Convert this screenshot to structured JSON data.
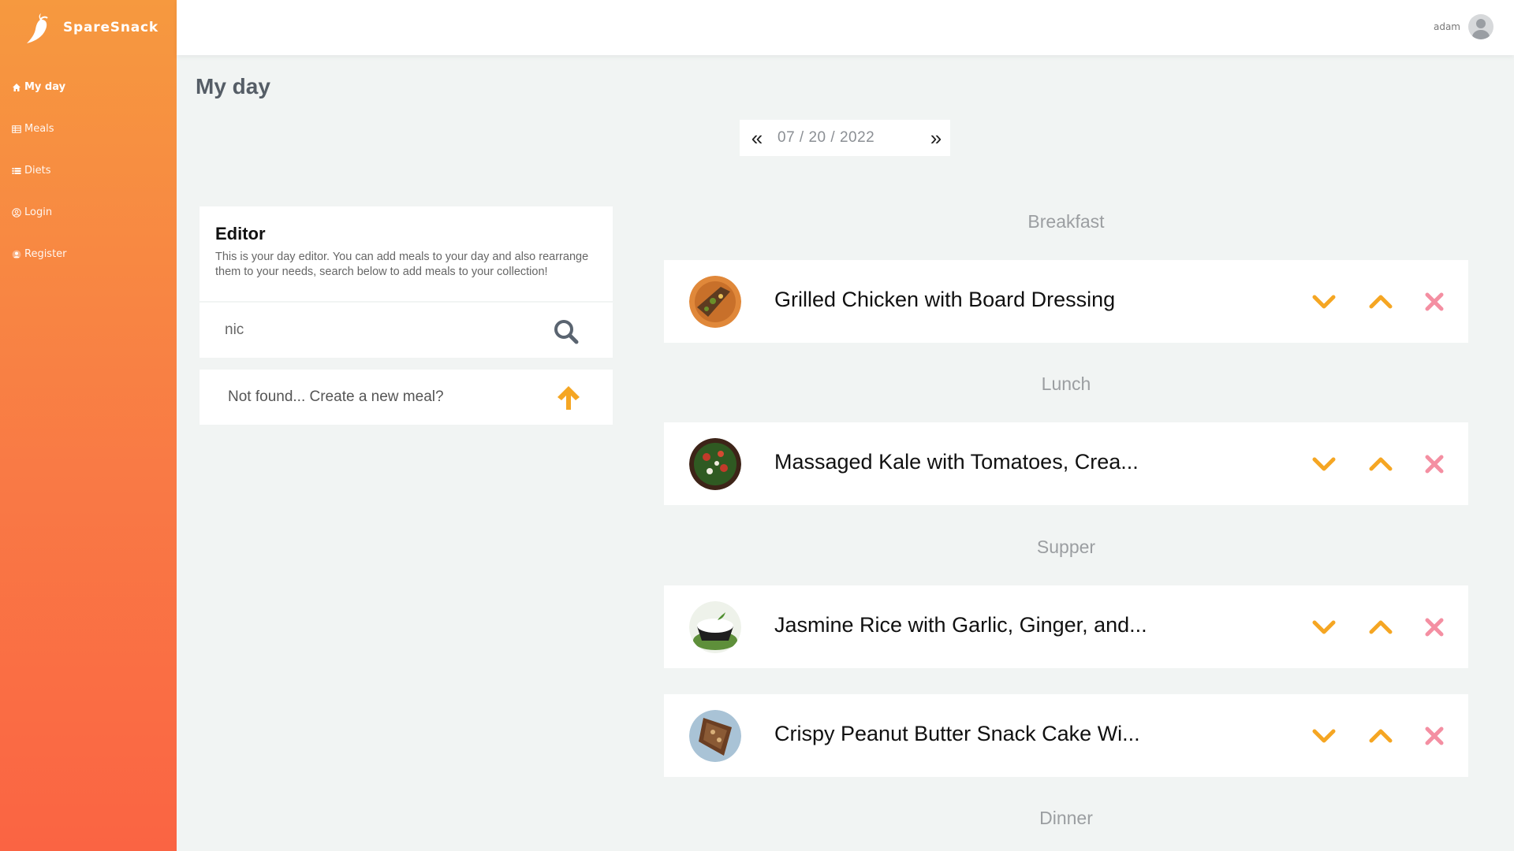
{
  "app": {
    "name": "SpareSnack"
  },
  "sidebar": {
    "items": [
      {
        "label": "My day",
        "icon": "home-icon",
        "active": true
      },
      {
        "label": "Meals",
        "icon": "table-icon",
        "active": false
      },
      {
        "label": "Diets",
        "icon": "list-icon",
        "active": false
      },
      {
        "label": "Login",
        "icon": "user-circle-icon",
        "active": false
      },
      {
        "label": "Register",
        "icon": "user-plus-icon",
        "active": false
      }
    ]
  },
  "topbar": {
    "username": "adam"
  },
  "page": {
    "title": "My day"
  },
  "datepicker": {
    "prev": "«",
    "value": "07 / 20 / 2022",
    "next": "»"
  },
  "editor": {
    "title": "Editor",
    "description": "This is your day editor. You can add meals to your day and also rearrange them to your needs, search below to add meals to your collection!",
    "search_value": "nic",
    "not_found_text": "Not found... Create a new meal?"
  },
  "sections": [
    {
      "label": "Breakfast"
    },
    {
      "label": "Lunch"
    },
    {
      "label": "Supper"
    },
    {
      "label": "Dinner"
    }
  ],
  "meals": [
    {
      "name": "Grilled Chicken with Board Dressing",
      "section": "Breakfast"
    },
    {
      "name": "Massaged Kale with Tomatoes, Crea...",
      "section": "Lunch"
    },
    {
      "name": "Jasmine Rice with Garlic, Ginger, and...",
      "section": "Supper"
    },
    {
      "name": "Crispy Peanut Butter Snack Cake Wi...",
      "section": "Supper"
    }
  ],
  "colors": {
    "accent": "#f5a623",
    "remove": "#f48fa2",
    "sidebar_top": "#f6993f",
    "sidebar_bottom": "#fa6443",
    "background": "#f1f4f3"
  }
}
